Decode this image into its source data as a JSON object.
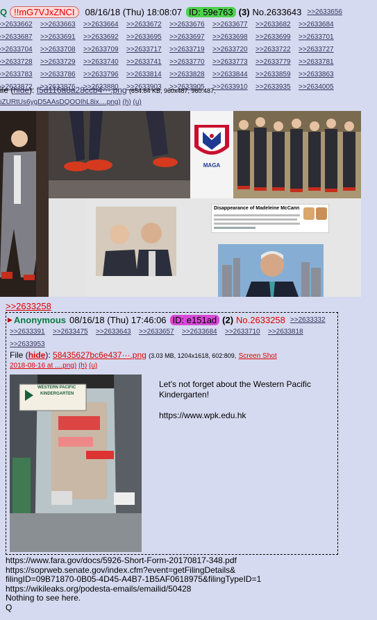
{
  "post": {
    "name_initial": "Q",
    "tripcode": "!!mG7VJxZNCI",
    "datetime": "08/16/18 (Thu) 18:08:07",
    "id_label": "ID: 59e763",
    "reply_count": "(3)",
    "post_number": "No.2633643",
    "backlink": ">>2633656",
    "replies": [
      ">>2633662",
      ">>2633663",
      ">>2633664",
      ">>2633672",
      ">>2633676",
      ">>2633677",
      ">>2633682",
      ">>2633684",
      ">>2633687",
      ">>2633691",
      ">>2633692",
      ">>2633695",
      ">>2633697",
      ">>2633698",
      ">>2633699",
      ">>2633701",
      ">>2633704",
      ">>2633708",
      ">>2633709",
      ">>2633717",
      ">>2633719",
      ">>2633720",
      ">>2633722",
      ">>2633727",
      ">>2633728",
      ">>2633729",
      ">>2633740",
      ">>2633741",
      ">>2633770",
      ">>2633773",
      ">>2633779",
      ">>2633781",
      ">>2633783",
      ">>2633786",
      ">>2633796",
      ">>2633814",
      ">>2633828",
      ">>2633844",
      ">>2633859",
      ">>2633863",
      ">>2633872",
      ">>2633876",
      ">>2633880",
      ">>2633903",
      ">>2633905",
      ">>2633910",
      ">>2633935",
      ">>2634005"
    ],
    "file": {
      "label": "ile",
      "hide": "hide",
      "filename": "f5d116a8a28ccb4···.png",
      "meta": "(654.64 KB, 960x487, 960:487,",
      "line2": "oZURtUs6ygD5AAsDQOOIhL8ix....png)",
      "h": "(h)",
      "u": "(u)"
    },
    "collage": {
      "maga_text": "MAGA",
      "article_title": "Disappearance of Madeleine McCann"
    }
  },
  "quote_link": ">>2633258",
  "nested": {
    "name": "Anonymous",
    "datetime": "08/16/18 (Thu) 17:46:06",
    "id_label": "ID: e151ad",
    "reply_count": "(2)",
    "post_number": "No.2633258",
    "backlink": ">>2633332",
    "replies": [
      ">>2633391",
      ">>2633475",
      ">>2633643",
      ">>2633657",
      ">>2633684",
      ">>2633710",
      ">>2633818",
      ">>2633953"
    ],
    "file": {
      "label": "File",
      "hide": "hide",
      "filename": "58435627bc6e437···.png",
      "meta": "(3.03 MB, 1204x1618, 602:809,",
      "screen_shot": "Screen Shot",
      "line2": "2018-08-16 at ....png)",
      "h": "(h)",
      "u": "(u)"
    },
    "sign_text_1": "WESTERN PACIFIC",
    "sign_text_2": "KINDERGARTEN",
    "message": [
      "Let's not forget about the Western Pacific Kindergarten!",
      "https://www.wpk.edu.hk"
    ]
  },
  "bottom_lines": [
    "https://www.fara.gov/docs/5926-Short-Form-20170817-348.pdf",
    "https://soprweb.senate.gov/index.cfm?event=getFilingDetails&",
    "filingID=09B71870-0B05-4D45-A4B7-1B5AF0618975&filingTypeID=1",
    "https://wikileaks.org/podesta-emails/emailid/50428",
    "Nothing to see here.",
    "Q"
  ]
}
